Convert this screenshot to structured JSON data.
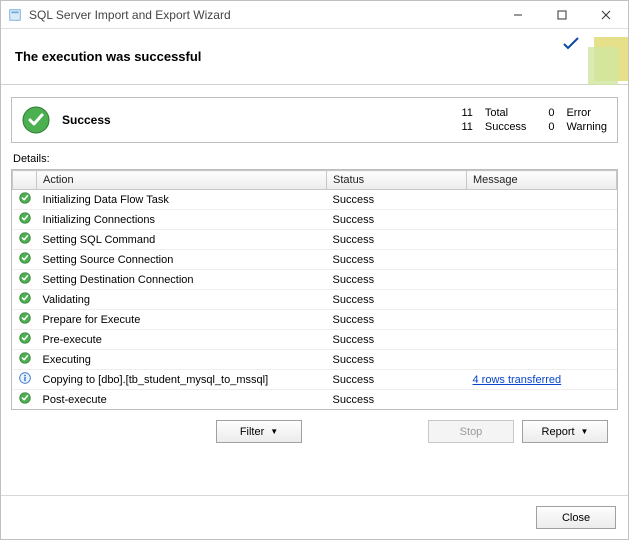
{
  "window": {
    "title": "SQL Server Import and Export Wizard"
  },
  "header": {
    "subtitle": "The execution was successful"
  },
  "summary": {
    "status_label": "Success",
    "total_count": "11",
    "total_label": "Total",
    "success_count": "11",
    "success_label": "Success",
    "error_count": "0",
    "error_label": "Error",
    "warning_count": "0",
    "warning_label": "Warning"
  },
  "details_label": "Details:",
  "columns": {
    "action": "Action",
    "status": "Status",
    "message": "Message"
  },
  "rows": [
    {
      "icon": "success",
      "action": "Initializing Data Flow Task",
      "status": "Success",
      "message": ""
    },
    {
      "icon": "success",
      "action": "Initializing Connections",
      "status": "Success",
      "message": ""
    },
    {
      "icon": "success",
      "action": "Setting SQL Command",
      "status": "Success",
      "message": ""
    },
    {
      "icon": "success",
      "action": "Setting Source Connection",
      "status": "Success",
      "message": ""
    },
    {
      "icon": "success",
      "action": "Setting Destination Connection",
      "status": "Success",
      "message": ""
    },
    {
      "icon": "success",
      "action": "Validating",
      "status": "Success",
      "message": ""
    },
    {
      "icon": "success",
      "action": "Prepare for Execute",
      "status": "Success",
      "message": ""
    },
    {
      "icon": "success",
      "action": "Pre-execute",
      "status": "Success",
      "message": ""
    },
    {
      "icon": "success",
      "action": "Executing",
      "status": "Success",
      "message": ""
    },
    {
      "icon": "info",
      "action": "Copying to [dbo].[tb_student_mysql_to_mssql]",
      "status": "Success",
      "message": "4 rows transferred",
      "link": true
    },
    {
      "icon": "success",
      "action": "Post-execute",
      "status": "Success",
      "message": ""
    }
  ],
  "buttons": {
    "filter": "Filter",
    "stop": "Stop",
    "report": "Report",
    "close": "Close"
  }
}
